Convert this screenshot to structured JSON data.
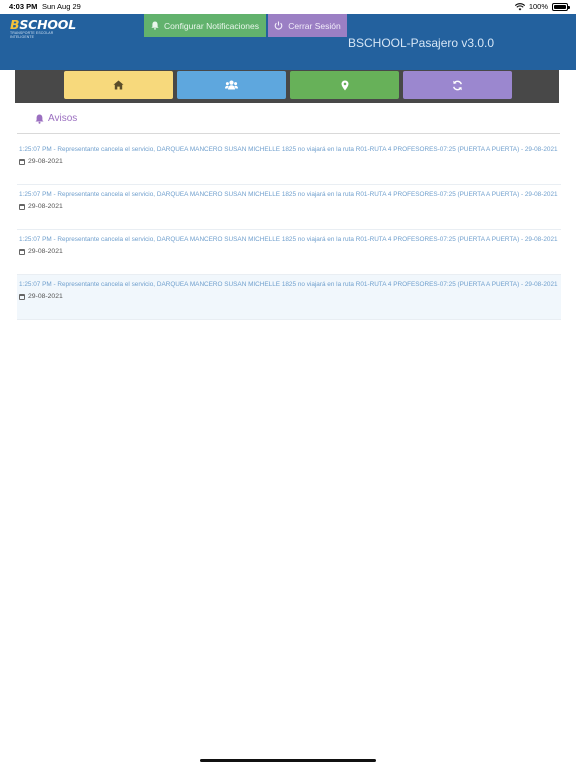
{
  "status": {
    "time": "4:03 PM",
    "date": "Sun Aug 29",
    "battery": "100%"
  },
  "header": {
    "logo_brand_first": "B",
    "logo_brand_rest": "SCHOOL",
    "logo_tag": "TRANSPORTE ESCOLAR INTELIGENTE",
    "notif_button": "Configurar Notificaciones",
    "logout_button": "Cerrar Sesión",
    "app_version": "BSCHOOL-Pasajero v3.0.0"
  },
  "section": {
    "title": "Avisos"
  },
  "notifications": [
    {
      "message": "1:25:07 PM - Representante cancela el servicio, DARQUEA MANCERO SUSAN MICHELLE 1825 no viajará en la ruta R01-RUTA 4 PROFESORES-07:25 (PUERTA A PUERTA) - 29-08-2021",
      "date": "29-08-2021"
    },
    {
      "message": "1:25:07 PM - Representante cancela el servicio, DARQUEA MANCERO SUSAN MICHELLE 1825 no viajará en la ruta R01-RUTA 4 PROFESORES-07:25 (PUERTA A PUERTA) - 29-08-2021",
      "date": "29-08-2021"
    },
    {
      "message": "1:25:07 PM - Representante cancela el servicio, DARQUEA MANCERO SUSAN MICHELLE 1825 no viajará en la ruta R01-RUTA 4 PROFESORES-07:25 (PUERTA A PUERTA) - 29-08-2021",
      "date": "29-08-2021"
    },
    {
      "message": "1:25:07 PM - Representante cancela el servicio, DARQUEA MANCERO SUSAN MICHELLE 1825 no viajará en la ruta R01-RUTA 4 PROFESORES-07:25 (PUERTA A PUERTA) - 29-08-2021",
      "date": "29-08-2021"
    }
  ],
  "icons": {
    "nav": [
      "home-icon",
      "users-icon",
      "map-marker-icon",
      "refresh-icon"
    ],
    "section": "bell-icon",
    "notif_button": "bell-icon",
    "logout_button": "power-icon",
    "item_date": "calendar-icon"
  },
  "colors": {
    "header_bg": "#23619e",
    "notif_button_bg": "#62b26d",
    "logout_button_bg": "#9b7fc4",
    "nav_home": "#f7d97c",
    "nav_group": "#5ea7de",
    "nav_location": "#67b159",
    "nav_sync": "#9b87cf",
    "section_title": "#9b6fc0",
    "message_text": "#6f9fcd"
  }
}
